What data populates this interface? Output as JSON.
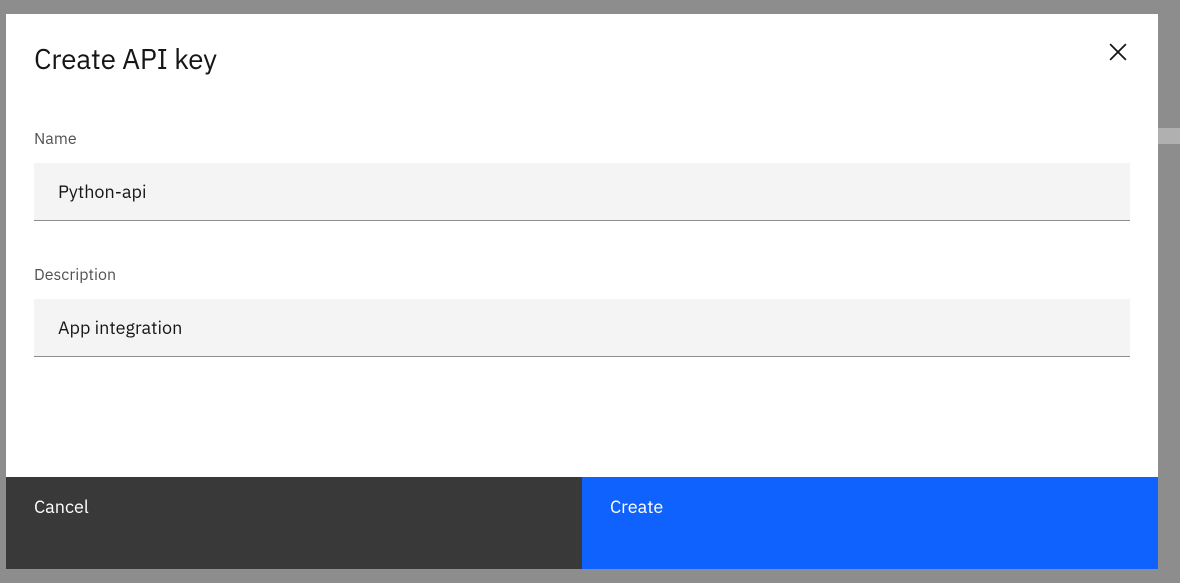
{
  "modal": {
    "title": "Create API key",
    "fields": {
      "name": {
        "label": "Name",
        "value": "Python-api"
      },
      "description": {
        "label": "Description",
        "value": "App integration"
      }
    },
    "actions": {
      "cancel": "Cancel",
      "create": "Create"
    }
  }
}
